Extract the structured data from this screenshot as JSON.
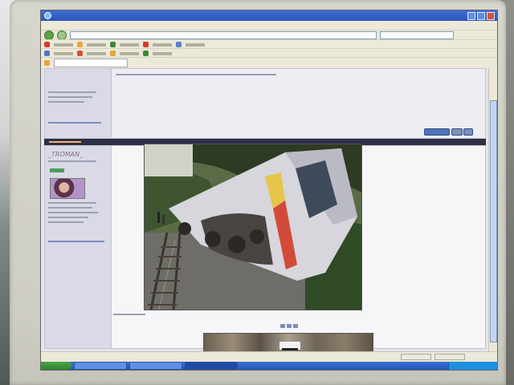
{
  "scene": {
    "description_hidden": "",
    "colors": {
      "bezel": "#d7d6cc",
      "xp_blue": "#2a55b8",
      "forum_sidebar": "#d9dae6",
      "forum_header": "#2c2f45"
    }
  },
  "browser": {
    "title_text": "",
    "icons": [
      "ie-icon",
      "back-icon",
      "forward-icon"
    ]
  },
  "forum": {
    "post1": {
      "username": ""
    },
    "post2": {
      "username": "_TROMAN_"
    }
  },
  "photo": {
    "subject_icon": "derailed-train-photo"
  }
}
